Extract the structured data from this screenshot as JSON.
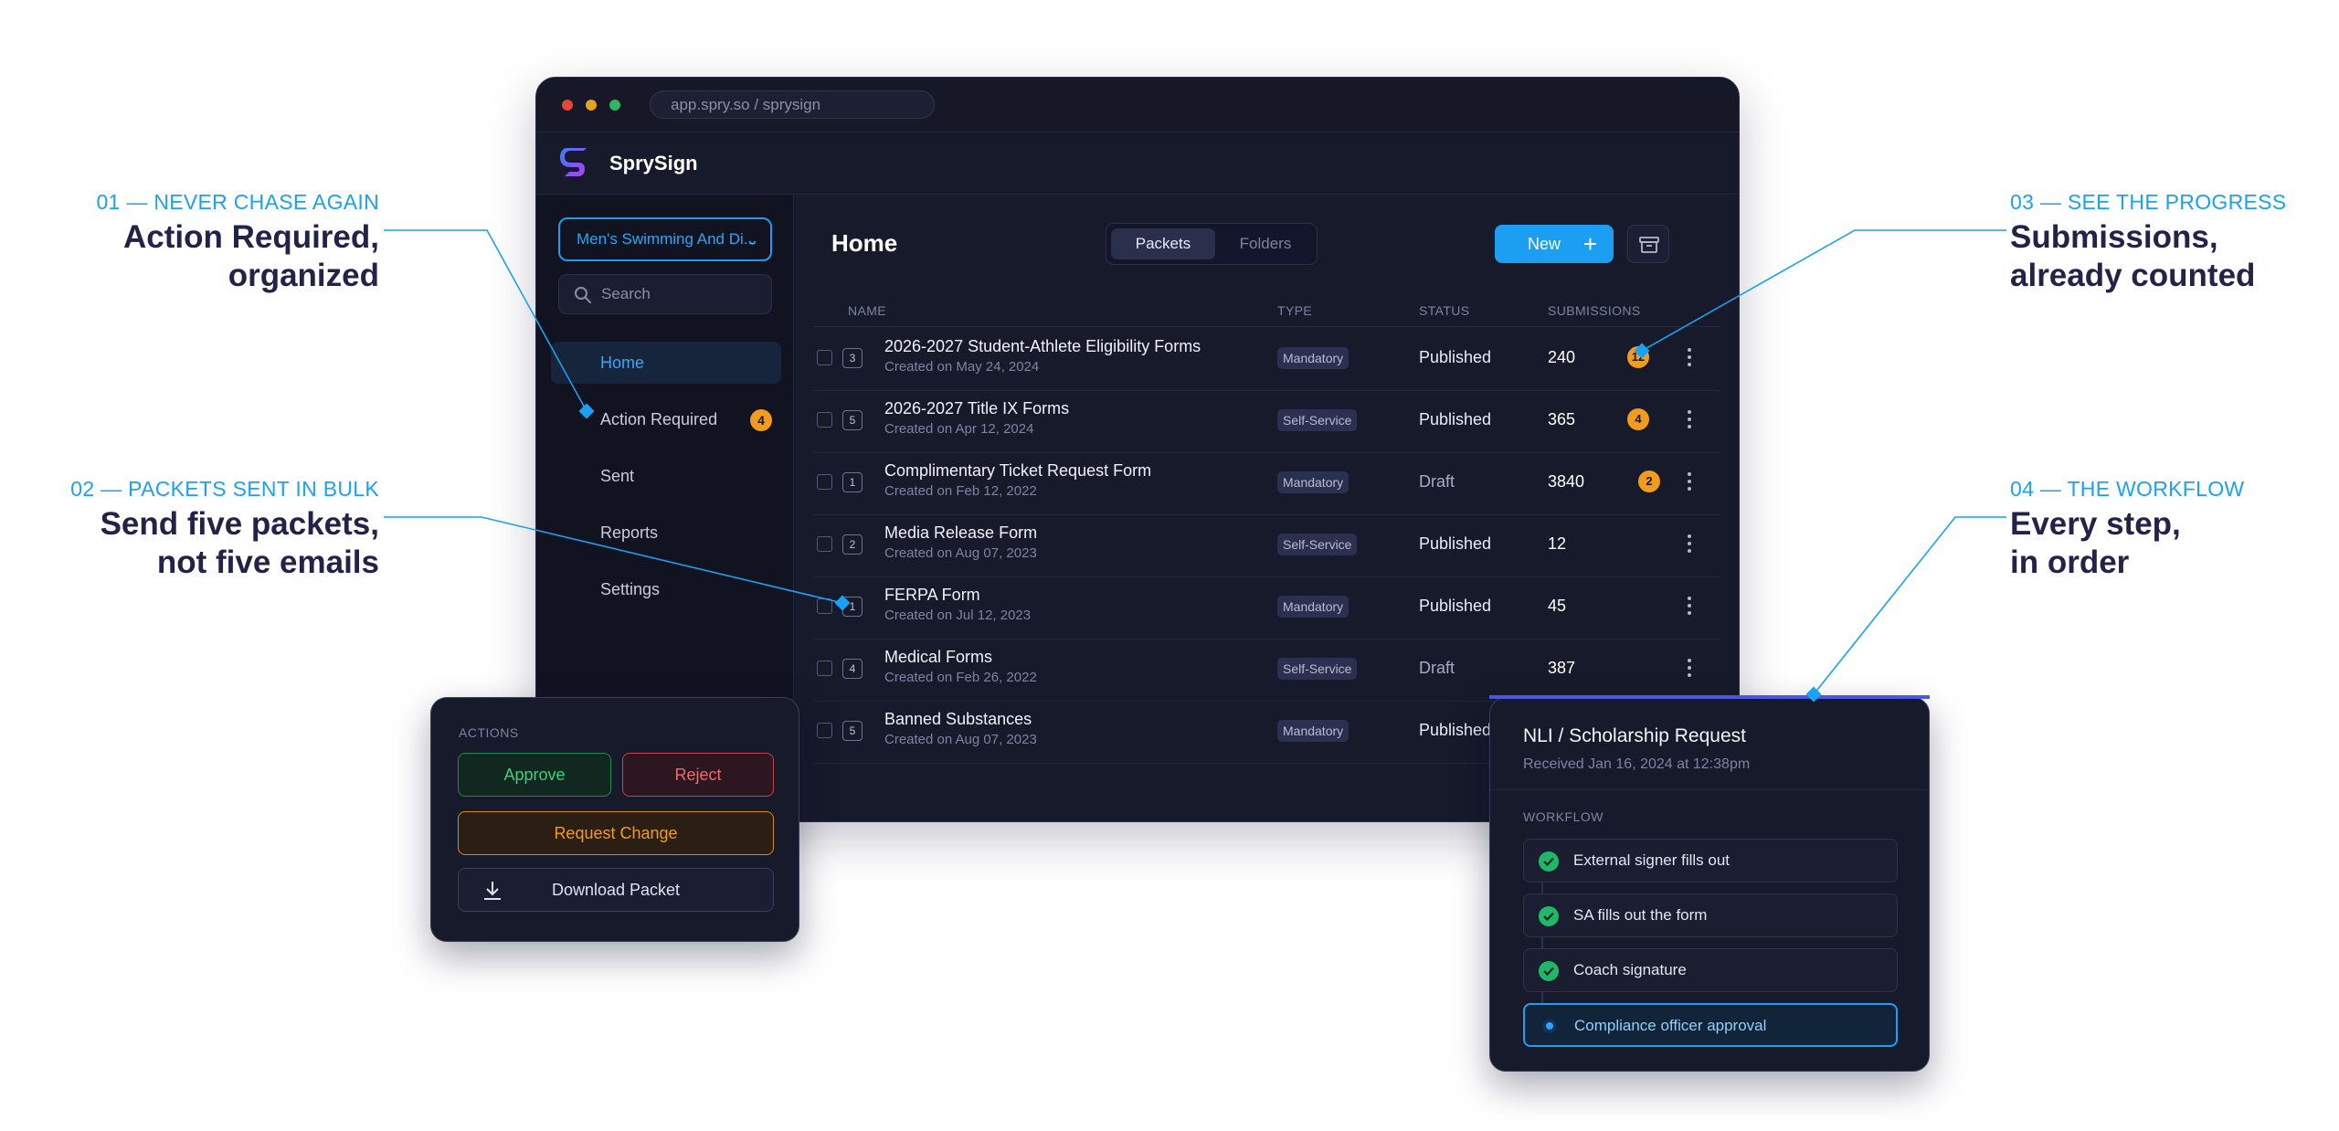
{
  "callouts": [
    {
      "kicker": "01 — NEVER CHASE AGAIN",
      "line1": "Action Required,",
      "line2": "organized"
    },
    {
      "kicker": "02 — PACKETS SENT IN BULK",
      "line1": "Send five packets,",
      "line2": "not five emails"
    },
    {
      "kicker": "03 — SEE THE PROGRESS",
      "line1": "Submissions,",
      "line2": "already counted"
    },
    {
      "kicker": "04 — THE WORKFLOW",
      "line1": "Every step,",
      "line2": "in order"
    }
  ],
  "browser": {
    "url": "app.spry.so / sprysign"
  },
  "app": {
    "brand": "SprySign"
  },
  "sidebar": {
    "team": "Men's Swimming And Di...",
    "search_placeholder": "Search",
    "items": [
      {
        "label": "Home",
        "active": true
      },
      {
        "label": "Action Required",
        "badge": "4"
      },
      {
        "label": "Sent"
      },
      {
        "label": "Reports"
      },
      {
        "label": "Settings"
      }
    ]
  },
  "main": {
    "title": "Home",
    "tabs": [
      "Packets",
      "Folders"
    ],
    "new_button": "New",
    "columns": {
      "name": "NAME",
      "type": "TYPE",
      "status": "STATUS",
      "submissions": "SUBMISSIONS"
    },
    "rows": [
      {
        "count": "3",
        "name": "2026-2027 Student-Athlete Eligibility Forms",
        "created": "Created on May 24, 2024",
        "type": "Mandatory",
        "status": "Published",
        "submissions": "240",
        "pending": "12"
      },
      {
        "count": "5",
        "name": "2026-2027 Title IX Forms",
        "created": "Created on Apr 12, 2024",
        "type": "Self-Service",
        "status": "Published",
        "submissions": "365",
        "pending": "4"
      },
      {
        "count": "1",
        "name": "Complimentary Ticket Request Form",
        "created": "Created on Feb 12, 2022",
        "type": "Mandatory",
        "status": "Draft",
        "submissions": "3840",
        "pending": "2"
      },
      {
        "count": "2",
        "name": "Media Release Form",
        "created": "Created on Aug 07, 2023",
        "type": "Self-Service",
        "status": "Published",
        "submissions": "12",
        "pending": ""
      },
      {
        "count": "1",
        "name": "FERPA Form",
        "created": "Created on Jul 12, 2023",
        "type": "Mandatory",
        "status": "Published",
        "submissions": "45",
        "pending": ""
      },
      {
        "count": "4",
        "name": "Medical Forms",
        "created": "Created on Feb 26, 2022",
        "type": "Self-Service",
        "status": "Draft",
        "submissions": "387",
        "pending": ""
      },
      {
        "count": "5",
        "name": "Banned Substances",
        "created": "Created on Aug 07, 2023",
        "type": "Mandatory",
        "status": "Published",
        "submissions": "",
        "pending": ""
      }
    ]
  },
  "actions": {
    "label": "ACTIONS",
    "approve": "Approve",
    "reject": "Reject",
    "request_change": "Request Change",
    "download": "Download Packet"
  },
  "workflow": {
    "title": "NLI / Scholarship Request",
    "received": "Received Jan 16, 2024 at 12:38pm",
    "label": "WORKFLOW",
    "steps": [
      {
        "label": "External signer fills out",
        "state": "done"
      },
      {
        "label": "SA fills out the form",
        "state": "done"
      },
      {
        "label": "Coach signature",
        "state": "done"
      },
      {
        "label": "Compliance officer approval",
        "state": "current"
      }
    ]
  },
  "colors": {
    "accent": "#1c9ff2",
    "badge": "#f39b1c",
    "success": "#1fb869",
    "danger": "#c2414c",
    "headline": "#23234a"
  }
}
